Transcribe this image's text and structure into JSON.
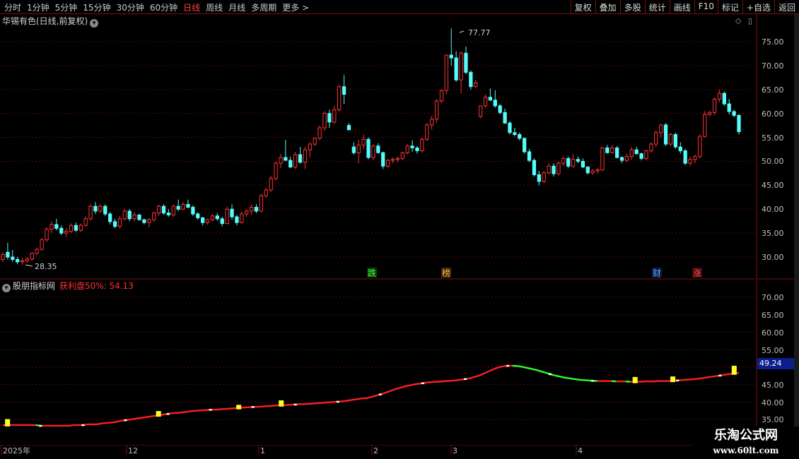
{
  "toolbar": {
    "periods": [
      "分时",
      "1分钟",
      "5分钟",
      "15分钟",
      "30分钟",
      "60分钟",
      "日线",
      "周线",
      "月线",
      "多周期",
      "更多 >"
    ],
    "active_period": "日线",
    "right_buttons": [
      "复权",
      "叠加",
      "多股",
      "统计",
      "画线",
      "F10",
      "标记",
      "+自选",
      "返回"
    ]
  },
  "main_chart": {
    "title": "华锡有色(日线,前复权)",
    "high_label": "77.77",
    "low_label": "28.35",
    "y_ticks": [
      "75.00",
      "70.00",
      "65.00",
      "60.00",
      "55.00",
      "50.00",
      "45.00",
      "40.00",
      "35.00",
      "30.00"
    ],
    "event_badges": [
      "跌",
      "榜",
      "财",
      "涨"
    ]
  },
  "indicator": {
    "name": "股朋指标网",
    "label": "获利盘50%: 54.13",
    "y_ticks": [
      "70.00",
      "65.00",
      "60.00",
      "55.00",
      "50.00",
      "45.00",
      "40.00",
      "35.00"
    ],
    "current_value": "49.24"
  },
  "x_axis": {
    "labels": [
      "2025年",
      "12",
      "1",
      "2",
      "3",
      "4"
    ]
  },
  "watermark": {
    "line1": "乐淘公式网",
    "line2": "www.60lt.com"
  },
  "chart_data": {
    "type": "candlestick",
    "y_range": [
      27,
      78
    ],
    "up_color": "#ff3232",
    "down_color": "#54fcfc",
    "candles": [
      [
        29.5,
        31,
        29,
        30.5
      ],
      [
        31,
        33,
        29.5,
        30
      ],
      [
        30,
        31.5,
        29,
        29.5
      ],
      [
        29.5,
        30,
        28.5,
        29
      ],
      [
        29,
        29.8,
        28.35,
        29.2
      ],
      [
        29.2,
        30,
        28.8,
        29.6
      ],
      [
        29.6,
        31,
        29.2,
        30.8
      ],
      [
        30.8,
        32,
        30.4,
        31.6
      ],
      [
        31.6,
        34,
        31.4,
        33.6
      ],
      [
        33.6,
        36.2,
        33.2,
        35.8
      ],
      [
        35.8,
        37.5,
        35,
        36.8
      ],
      [
        36.8,
        38,
        35.6,
        36
      ],
      [
        36,
        36.6,
        34.6,
        35
      ],
      [
        35,
        36,
        34.2,
        35.4
      ],
      [
        35.4,
        37,
        35,
        36.6
      ],
      [
        36.6,
        37.2,
        35.2,
        35.6
      ],
      [
        35.6,
        37,
        35.2,
        36.6
      ],
      [
        36.6,
        38.5,
        36.4,
        38
      ],
      [
        38,
        41,
        37.6,
        40.6
      ],
      [
        40.6,
        41.5,
        39,
        39.6
      ],
      [
        39.6,
        41,
        39.2,
        40.6
      ],
      [
        40.6,
        41,
        38.6,
        39
      ],
      [
        39,
        39.4,
        36.8,
        37.4
      ],
      [
        37.4,
        38,
        36,
        36.4
      ],
      [
        36.4,
        38.5,
        36,
        38
      ],
      [
        38,
        40,
        37.6,
        39.6
      ],
      [
        39.6,
        40,
        37.5,
        38
      ],
      [
        38,
        39.4,
        37.4,
        38.8
      ],
      [
        38.8,
        39,
        37.6,
        37.8
      ],
      [
        37.8,
        38,
        36.8,
        37.2
      ],
      [
        37.2,
        38.2,
        36.2,
        37.8
      ],
      [
        37.8,
        39.5,
        37.4,
        39.2
      ],
      [
        39.2,
        41,
        38.6,
        40.6
      ],
      [
        40.6,
        41,
        38.8,
        39.2
      ],
      [
        39.2,
        40,
        38.4,
        38.8
      ],
      [
        38.8,
        41,
        38.4,
        40.6
      ],
      [
        40.6,
        42,
        39.6,
        40
      ],
      [
        40,
        41.5,
        39.8,
        41
      ],
      [
        41,
        42,
        40.2,
        40.4
      ],
      [
        40.4,
        40.8,
        38.6,
        39
      ],
      [
        39,
        39.4,
        37.8,
        38.2
      ],
      [
        38.2,
        38.4,
        36.6,
        37.2
      ],
      [
        37.2,
        38,
        36.8,
        37.8
      ],
      [
        37.8,
        39,
        37.4,
        38.6
      ],
      [
        38.6,
        39.2,
        37.6,
        38
      ],
      [
        38,
        38.4,
        36.4,
        37
      ],
      [
        37,
        40.5,
        36.8,
        40
      ],
      [
        40,
        41,
        37.8,
        38.4
      ],
      [
        38.4,
        38.8,
        36.6,
        37.2
      ],
      [
        37.2,
        39.5,
        37,
        39
      ],
      [
        39,
        40,
        38.4,
        39.6
      ],
      [
        39.6,
        41,
        38.8,
        40.4
      ],
      [
        40.4,
        41,
        39.2,
        39.6
      ],
      [
        39.6,
        43.2,
        39.4,
        42.8
      ],
      [
        42.8,
        44.5,
        42.4,
        44
      ],
      [
        44,
        47,
        43.6,
        46.4
      ],
      [
        46.4,
        50,
        46,
        49.6
      ],
      [
        49.6,
        51.5,
        48.6,
        50.8
      ],
      [
        50.8,
        54.5,
        50.4,
        50.2
      ],
      [
        50.2,
        51,
        48.6,
        48.8
      ],
      [
        48.8,
        52,
        48.4,
        51.4
      ],
      [
        51.4,
        53,
        49.5,
        49.8
      ],
      [
        49.8,
        53,
        48.4,
        52.4
      ],
      [
        52.4,
        54,
        50.8,
        53.6
      ],
      [
        53.6,
        55,
        53.2,
        54.8
      ],
      [
        54.8,
        57.5,
        54.4,
        57
      ],
      [
        57,
        60.5,
        56.4,
        60
      ],
      [
        60,
        60.8,
        57,
        58.2
      ],
      [
        58.2,
        61.5,
        57.8,
        60.8
      ],
      [
        60.8,
        66,
        60.4,
        65.6
      ],
      [
        65.6,
        68,
        62,
        64
      ],
      [
        57.5,
        58,
        56.4,
        56.6
      ],
      [
        53,
        54,
        51.4,
        51.8
      ],
      [
        51.8,
        54.5,
        49.6,
        53.4
      ],
      [
        53.4,
        55.6,
        52.6,
        54.6
      ],
      [
        54.6,
        55,
        50.4,
        50.8
      ],
      [
        50.8,
        53.6,
        50.2,
        53.2
      ],
      [
        53.2,
        53.8,
        51.6,
        51.8
      ],
      [
        51.8,
        52,
        48.4,
        49
      ],
      [
        49,
        50.5,
        48.6,
        50.2
      ],
      [
        50.2,
        50.8,
        49.6,
        50.4
      ],
      [
        50.4,
        51,
        49.8,
        50.6
      ],
      [
        50.6,
        52,
        50.2,
        51.8
      ],
      [
        51.8,
        53.6,
        51.4,
        53.2
      ],
      [
        53.2,
        54.4,
        52,
        52.8
      ],
      [
        52.8,
        53.2,
        51.6,
        52.2
      ],
      [
        52.2,
        55,
        51.8,
        54.6
      ],
      [
        54.6,
        58,
        54.2,
        57.6
      ],
      [
        57.6,
        59.5,
        56.6,
        58.8
      ],
      [
        58.8,
        63,
        58,
        62.6
      ],
      [
        62.6,
        65,
        62.2,
        64.8
      ],
      [
        64.8,
        72,
        64,
        72.2
      ],
      [
        72.2,
        77.77,
        70,
        71.6
      ],
      [
        71.6,
        73,
        66.6,
        67
      ],
      [
        67,
        73,
        64.2,
        72.6
      ],
      [
        72.6,
        74,
        68.2,
        68.6
      ],
      [
        68.6,
        69,
        65,
        65.6
      ],
      [
        65.6,
        67,
        65.4,
        66.4
      ],
      [
        59.4,
        61,
        59,
        61.6
      ],
      [
        61.6,
        64,
        61.2,
        63.4
      ],
      [
        63.4,
        65.2,
        62.6,
        62.8
      ],
      [
        62.8,
        64.8,
        61.2,
        61.6
      ],
      [
        61.6,
        62,
        59.8,
        60.2
      ],
      [
        60.2,
        61,
        57.8,
        58
      ],
      [
        58,
        58.4,
        55.6,
        56
      ],
      [
        56,
        57,
        55.2,
        55.6
      ],
      [
        55.6,
        56,
        54.4,
        54.8
      ],
      [
        54.8,
        55,
        51.6,
        52
      ],
      [
        52,
        52.6,
        49.8,
        50.2
      ],
      [
        50.2,
        50.6,
        46.8,
        47.2
      ],
      [
        47.2,
        48,
        45,
        45.8
      ],
      [
        45.8,
        48,
        45.4,
        47.6
      ],
      [
        47.6,
        49.6,
        47.2,
        49
      ],
      [
        49,
        49.6,
        46.8,
        47.4
      ],
      [
        47.4,
        50,
        47,
        49.6
      ],
      [
        49.6,
        51,
        49,
        50.6
      ],
      [
        50.6,
        51,
        48.6,
        49
      ],
      [
        49,
        51.5,
        48.6,
        50.4
      ],
      [
        50.4,
        51,
        49.6,
        50
      ],
      [
        50,
        50.6,
        48.6,
        48.8
      ],
      [
        48.8,
        49,
        47.2,
        47.6
      ],
      [
        47.6,
        48.4,
        47.2,
        48
      ],
      [
        48,
        48.6,
        47.4,
        48.2
      ],
      [
        48.2,
        53,
        48,
        52.8
      ],
      [
        52.8,
        53.4,
        51.6,
        51.8
      ],
      [
        51.8,
        53.4,
        51.6,
        52.8
      ],
      [
        52.8,
        53.2,
        50.6,
        50.8
      ],
      [
        50.8,
        51,
        49.6,
        50.2
      ],
      [
        50.2,
        51.6,
        49.8,
        51
      ],
      [
        51,
        53,
        50.4,
        52.4
      ],
      [
        52.4,
        53,
        51.4,
        51.6
      ],
      [
        51.6,
        51.8,
        50.2,
        50.6
      ],
      [
        50.6,
        52.4,
        50.2,
        52.2
      ],
      [
        52.2,
        54,
        51.8,
        53.6
      ],
      [
        53.6,
        56.5,
        53,
        56
      ],
      [
        56,
        57.8,
        55,
        57.6
      ],
      [
        57.6,
        58,
        53.2,
        53.6
      ],
      [
        53.6,
        56,
        53.2,
        55.6
      ],
      [
        55.6,
        56,
        52.6,
        53
      ],
      [
        53,
        54,
        51.6,
        52.2
      ],
      [
        52.2,
        52.6,
        49.2,
        49.6
      ],
      [
        49.6,
        51,
        49,
        50.4
      ],
      [
        50.4,
        51.4,
        49.6,
        51
      ],
      [
        51,
        55.6,
        50.6,
        55.2
      ],
      [
        55.2,
        60.5,
        55,
        59.8
      ],
      [
        59.8,
        60.6,
        59.4,
        60.2
      ],
      [
        60.2,
        63.4,
        59.6,
        63
      ],
      [
        63,
        65,
        62.4,
        64.2
      ],
      [
        64.2,
        64.6,
        61.6,
        62
      ],
      [
        62,
        63,
        59.8,
        60.4
      ],
      [
        60.4,
        60.8,
        59.2,
        59.6
      ],
      [
        59.6,
        59.8,
        55.6,
        56.2
      ]
    ],
    "indicator_series": [
      38.0,
      38.0,
      38.0,
      38.0,
      38.0,
      38.0,
      38.0,
      38.0,
      37.8,
      37.8,
      37.8,
      37.8,
      37.8,
      37.8,
      37.8,
      38.0,
      38.0,
      38.0,
      38.2,
      38.2,
      38.2,
      38.5,
      38.6,
      38.7,
      38.9,
      39.2,
      39.4,
      39.6,
      39.8,
      40.0,
      40.2,
      40.4,
      40.6,
      40.8,
      41.0,
      41.2,
      41.4,
      41.5,
      41.6,
      41.8,
      42.0,
      42.1,
      42.2,
      42.3,
      42.4,
      42.4,
      42.5,
      42.6,
      42.7,
      42.8,
      42.9,
      43.0,
      43.1,
      43.2,
      43.2,
      43.3,
      43.4,
      43.5,
      43.6,
      43.7,
      43.7,
      43.8,
      43.9,
      44.0,
      44.0,
      44.1,
      44.2,
      44.3,
      44.4,
      44.5,
      44.6,
      44.7,
      44.8,
      45.0,
      45.2,
      45.4,
      45.6,
      45.7,
      46.0,
      46.4,
      46.8,
      47.2,
      47.7,
      48.2,
      48.6,
      49.0,
      49.3,
      49.6,
      49.8,
      50.0,
      50.2,
      50.3,
      50.4,
      50.5,
      50.6,
      50.7,
      50.8,
      51.0,
      51.2,
      51.4,
      51.8,
      52.2,
      52.8,
      53.4,
      54.0,
      54.5,
      54.8,
      55.0,
      55.0,
      54.9,
      54.7,
      54.4,
      54.1,
      53.8,
      53.4,
      53.0,
      52.6,
      52.2,
      51.9,
      51.6,
      51.4,
      51.2,
      51.0,
      50.9,
      50.8,
      50.7,
      50.6,
      50.6,
      50.6,
      50.6,
      50.5,
      50.5,
      50.5,
      50.4,
      50.4,
      50.4,
      50.5,
      50.5,
      50.5,
      50.6,
      50.6,
      50.6,
      50.7,
      50.8,
      50.9,
      51.0,
      51.1,
      51.2,
      51.4,
      51.6,
      51.8,
      52.0,
      52.2,
      52.4,
      52.6,
      52.8,
      53.0
    ],
    "indicator_range": [
      33,
      74
    ],
    "indicator_markers": [
      [
        1,
        1.3
      ],
      [
        33,
        1.0
      ],
      [
        50,
        0.8
      ],
      [
        59,
        1.1
      ],
      [
        134,
        1.1
      ],
      [
        142,
        1.0
      ],
      [
        155,
        1.6
      ]
    ]
  }
}
